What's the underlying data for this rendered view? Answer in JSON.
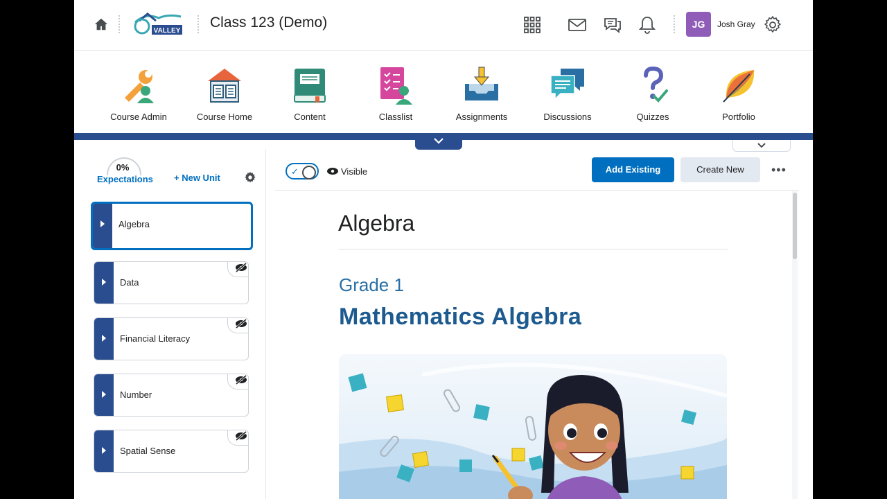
{
  "topbar": {
    "course_title": "Class 123 (Demo)",
    "logo_text": "VALLEY",
    "user_initials": "JG",
    "user_name": "Josh Gray",
    "icons": [
      "home-icon",
      "apps-grid-icon",
      "mail-icon",
      "chat-icon",
      "bell-icon",
      "gear-icon"
    ]
  },
  "nav": {
    "items": [
      {
        "label": "Course Admin",
        "icon": "course-admin-icon"
      },
      {
        "label": "Course Home",
        "icon": "course-home-icon"
      },
      {
        "label": "Content",
        "icon": "content-book-icon"
      },
      {
        "label": "Classlist",
        "icon": "classlist-icon"
      },
      {
        "label": "Assignments",
        "icon": "assignments-tray-icon"
      },
      {
        "label": "Discussions",
        "icon": "discussions-icon"
      },
      {
        "label": "Quizzes",
        "icon": "quiz-question-icon"
      },
      {
        "label": "Portfolio",
        "icon": "portfolio-leaf-icon"
      }
    ],
    "accent": "#2a4d8f"
  },
  "left": {
    "expectations_pct": "0%",
    "expectations_label": "Expectations",
    "new_unit_label": "New Unit",
    "units": [
      {
        "label": "Algebra",
        "hidden": false,
        "active": true
      },
      {
        "label": "Data",
        "hidden": true,
        "active": false
      },
      {
        "label": "Financial Literacy",
        "hidden": true,
        "active": false
      },
      {
        "label": "Number",
        "hidden": true,
        "active": false
      },
      {
        "label": "Spatial Sense",
        "hidden": true,
        "active": false
      }
    ]
  },
  "right": {
    "visible_label": "Visible",
    "visible_on": true,
    "add_existing_label": "Add Existing",
    "create_new_label": "Create New",
    "more_label": "•••",
    "title": "Algebra",
    "grade": "Grade 1",
    "subject": "Mathematics Algebra",
    "primary_color": "#006fbf"
  }
}
